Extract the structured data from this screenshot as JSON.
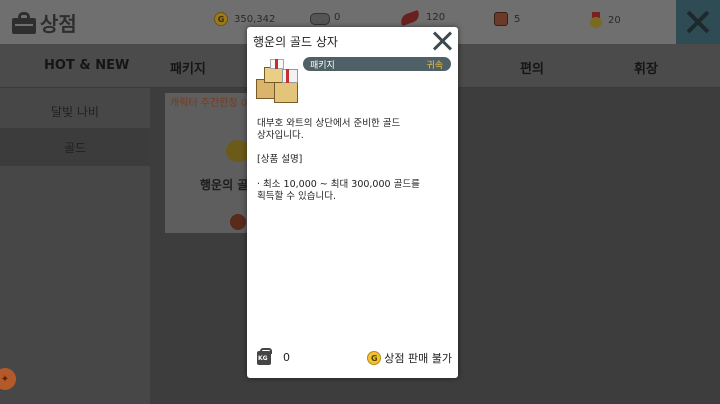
{
  "header": {
    "title": "상점",
    "close_icon": "close-icon",
    "resources": [
      {
        "icon": "gold-coin-icon",
        "value": "350,342"
      },
      {
        "icon": "dumbbell-icon",
        "value": "0"
      },
      {
        "icon": "feather-icon",
        "value": "120"
      },
      {
        "icon": "crest-icon",
        "value": "5"
      },
      {
        "icon": "medal-icon",
        "value": "20"
      }
    ]
  },
  "tabs": [
    "HOT & NEW",
    "패키지",
    "편의",
    "휘장"
  ],
  "sidebar": {
    "items": [
      {
        "label": "달빛 나비"
      },
      {
        "label": "골드"
      }
    ]
  },
  "card": {
    "tag": "캐릭터 주간한정 0",
    "name": "행운의 골"
  },
  "modal": {
    "title": "행운의 골드 상자",
    "category": "패키지",
    "bound": "귀속",
    "desc1": "대부호 와트의 상단에서 준비한 골드\n상자입니다.",
    "desc2": "[상품 설명]",
    "desc3": "· 최소 10,000 ~ 최대 300,000 골드를\n획득할 수 있습니다.",
    "weight": "0",
    "sell_text": "상점 판매 불가",
    "coin_letter": "G"
  },
  "colors": {
    "accent_gold": "#f3c234",
    "category_bar": "#4f6066",
    "close_button_bg": "#2f4c54"
  }
}
